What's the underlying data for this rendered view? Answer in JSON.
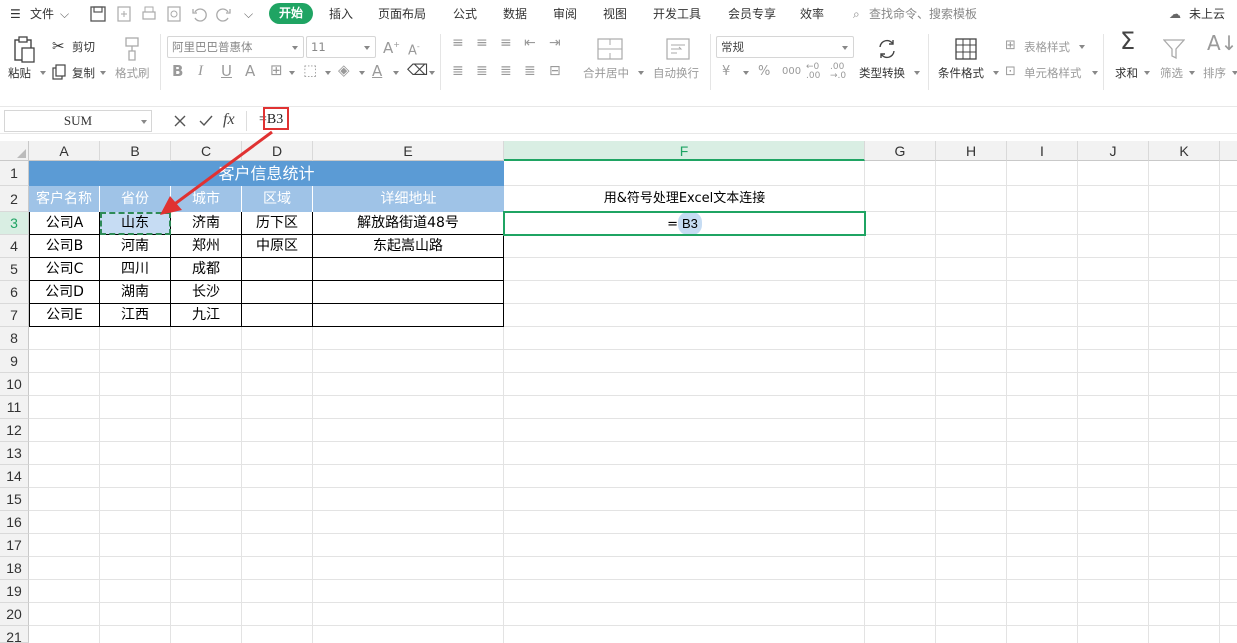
{
  "menubar": {
    "file_label": "文件",
    "tabs": [
      "开始",
      "插入",
      "页面布局",
      "公式",
      "数据",
      "审阅",
      "视图",
      "开发工具",
      "会员专享",
      "效率"
    ],
    "active_tab": "开始",
    "search_placeholder": "查找命令、搜索模板",
    "cloud_label": "未上云"
  },
  "ribbon": {
    "paste": "粘贴",
    "cut": "剪切",
    "copy": "复制",
    "format_painter": "格式刷",
    "font_name": "阿里巴巴普惠体",
    "font_size": "11",
    "merge_center": "合并居中",
    "wrap_text": "自动换行",
    "number_format": "常规",
    "type_convert": "类型转换",
    "conditional_format": "条件格式",
    "table_style": "表格样式",
    "cell_style": "单元格样式",
    "sum": "求和",
    "filter": "筛选",
    "sort": "排序"
  },
  "formula_bar": {
    "name_box": "SUM",
    "fx": "fx",
    "formula": "=B3"
  },
  "sheet": {
    "columns": [
      "A",
      "B",
      "C",
      "D",
      "E",
      "F",
      "G",
      "H",
      "I",
      "J",
      "K"
    ],
    "rows": [
      "1",
      "2",
      "3",
      "4",
      "5",
      "6",
      "7",
      "8",
      "9",
      "10",
      "11",
      "12",
      "13",
      "14",
      "15",
      "16",
      "17",
      "18",
      "19",
      "20",
      "21"
    ],
    "title": "客户信息统计",
    "headers": [
      "客户名称",
      "省份",
      "城市",
      "区域",
      "详细地址"
    ],
    "data": [
      [
        "公司A",
        "山东",
        "济南",
        "历下区",
        "解放路街道48号"
      ],
      [
        "公司B",
        "河南",
        "郑州",
        "中原区",
        "东起嵩山路"
      ],
      [
        "公司C",
        "四川",
        "成都",
        "",
        ""
      ],
      [
        "公司D",
        "湖南",
        "长沙",
        "",
        ""
      ],
      [
        "公司E",
        "江西",
        "九江",
        "",
        ""
      ]
    ],
    "f2_text": "用&符号处理Excel文本连接",
    "f3_eq": "=",
    "f3_ref": "B3"
  }
}
